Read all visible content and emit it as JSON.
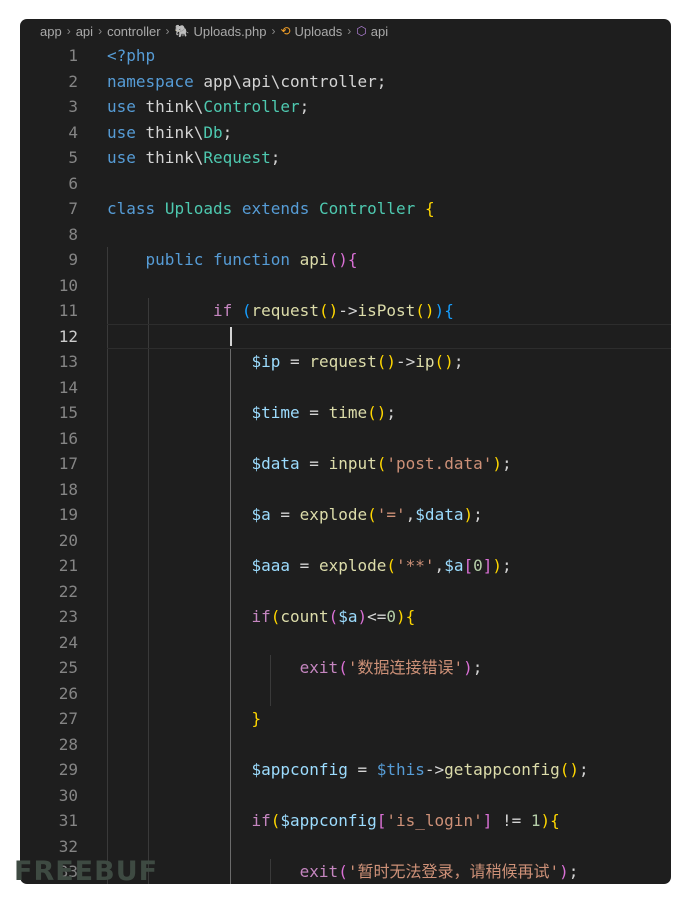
{
  "breadcrumb": [
    {
      "label": "app",
      "icon": null
    },
    {
      "label": "api",
      "icon": null
    },
    {
      "label": "controller",
      "icon": null
    },
    {
      "label": "Uploads.php",
      "icon": "php-file-icon"
    },
    {
      "label": "Uploads",
      "icon": "class-icon"
    },
    {
      "label": "api",
      "icon": "method-icon"
    }
  ],
  "editor": {
    "active_line": 12,
    "lines": [
      {
        "n": "1",
        "code": [
          [
            "<?php",
            "k"
          ]
        ]
      },
      {
        "n": "2",
        "code": [
          [
            "namespace",
            "k"
          ],
          [
            " app\\api\\controller;",
            "p"
          ]
        ]
      },
      {
        "n": "3",
        "code": [
          [
            "use",
            "k"
          ],
          [
            " think\\",
            "p"
          ],
          [
            "Controller",
            "t"
          ],
          [
            ";",
            "p"
          ]
        ]
      },
      {
        "n": "4",
        "code": [
          [
            "use",
            "k"
          ],
          [
            " think\\",
            "p"
          ],
          [
            "Db",
            "t"
          ],
          [
            ";",
            "p"
          ]
        ]
      },
      {
        "n": "5",
        "code": [
          [
            "use",
            "k"
          ],
          [
            " think\\",
            "p"
          ],
          [
            "Request",
            "t"
          ],
          [
            ";",
            "p"
          ]
        ]
      },
      {
        "n": "6",
        "code": []
      },
      {
        "n": "7",
        "code": [
          [
            "class",
            "k"
          ],
          [
            " ",
            "p"
          ],
          [
            "Uploads",
            "t"
          ],
          [
            " ",
            "p"
          ],
          [
            "extends",
            "k"
          ],
          [
            " ",
            "p"
          ],
          [
            "Controller",
            "t"
          ],
          [
            " ",
            "p"
          ],
          [
            "{",
            "b1"
          ]
        ]
      },
      {
        "n": "8",
        "code": []
      },
      {
        "n": "9",
        "code": [
          [
            "    ",
            "p"
          ],
          [
            "public",
            "k"
          ],
          [
            " ",
            "p"
          ],
          [
            "function",
            "k"
          ],
          [
            " ",
            "p"
          ],
          [
            "api",
            "f"
          ],
          [
            "()",
            "b2"
          ],
          [
            "{",
            "b2"
          ]
        ]
      },
      {
        "n": "10",
        "code": []
      },
      {
        "n": "11",
        "code": [
          [
            "           ",
            "p"
          ],
          [
            "if",
            "c"
          ],
          [
            " ",
            "p"
          ],
          [
            "(",
            "b3"
          ],
          [
            "request",
            "f"
          ],
          [
            "()",
            "b1"
          ],
          [
            "->",
            "p"
          ],
          [
            "isPost",
            "f"
          ],
          [
            "()",
            "b1"
          ],
          [
            ")",
            "b3"
          ],
          [
            "{",
            "b3"
          ]
        ]
      },
      {
        "n": "12",
        "code": []
      },
      {
        "n": "13",
        "code": [
          [
            "               ",
            "p"
          ],
          [
            "$ip",
            "v"
          ],
          [
            " = ",
            "p"
          ],
          [
            "request",
            "f"
          ],
          [
            "()",
            "b1"
          ],
          [
            "->",
            "p"
          ],
          [
            "ip",
            "f"
          ],
          [
            "()",
            "b1"
          ],
          [
            ";",
            "p"
          ]
        ]
      },
      {
        "n": "14",
        "code": []
      },
      {
        "n": "15",
        "code": [
          [
            "               ",
            "p"
          ],
          [
            "$time",
            "v"
          ],
          [
            " = ",
            "p"
          ],
          [
            "time",
            "f"
          ],
          [
            "()",
            "b1"
          ],
          [
            ";",
            "p"
          ]
        ]
      },
      {
        "n": "16",
        "code": []
      },
      {
        "n": "17",
        "code": [
          [
            "               ",
            "p"
          ],
          [
            "$data",
            "v"
          ],
          [
            " = ",
            "p"
          ],
          [
            "input",
            "f"
          ],
          [
            "(",
            "b1"
          ],
          [
            "'post.data'",
            "s"
          ],
          [
            ")",
            "b1"
          ],
          [
            ";",
            "p"
          ]
        ]
      },
      {
        "n": "18",
        "code": []
      },
      {
        "n": "19",
        "code": [
          [
            "               ",
            "p"
          ],
          [
            "$a",
            "v"
          ],
          [
            " = ",
            "p"
          ],
          [
            "explode",
            "f"
          ],
          [
            "(",
            "b1"
          ],
          [
            "'='",
            "s"
          ],
          [
            ",",
            "p"
          ],
          [
            "$data",
            "v"
          ],
          [
            ")",
            "b1"
          ],
          [
            ";",
            "p"
          ]
        ]
      },
      {
        "n": "20",
        "code": []
      },
      {
        "n": "21",
        "code": [
          [
            "               ",
            "p"
          ],
          [
            "$aaa",
            "v"
          ],
          [
            " = ",
            "p"
          ],
          [
            "explode",
            "f"
          ],
          [
            "(",
            "b1"
          ],
          [
            "'**'",
            "s"
          ],
          [
            ",",
            "p"
          ],
          [
            "$a",
            "v"
          ],
          [
            "[",
            "b2"
          ],
          [
            "0",
            "n"
          ],
          [
            "]",
            "b2"
          ],
          [
            ")",
            "b1"
          ],
          [
            ";",
            "p"
          ]
        ]
      },
      {
        "n": "22",
        "code": []
      },
      {
        "n": "23",
        "code": [
          [
            "               ",
            "p"
          ],
          [
            "if",
            "c"
          ],
          [
            "(",
            "b1"
          ],
          [
            "count",
            "f"
          ],
          [
            "(",
            "b2"
          ],
          [
            "$a",
            "v"
          ],
          [
            ")",
            "b2"
          ],
          [
            "<=",
            "p"
          ],
          [
            "0",
            "n"
          ],
          [
            ")",
            "b1"
          ],
          [
            "{",
            "b1"
          ]
        ]
      },
      {
        "n": "24",
        "code": []
      },
      {
        "n": "25",
        "code": [
          [
            "                    ",
            "p"
          ],
          [
            "exit",
            "c"
          ],
          [
            "(",
            "b2"
          ],
          [
            "'数据连接错误'",
            "s"
          ],
          [
            ")",
            "b2"
          ],
          [
            ";",
            "p"
          ]
        ]
      },
      {
        "n": "26",
        "code": []
      },
      {
        "n": "27",
        "code": [
          [
            "               ",
            "p"
          ],
          [
            "}",
            "b1"
          ]
        ]
      },
      {
        "n": "28",
        "code": []
      },
      {
        "n": "29",
        "code": [
          [
            "               ",
            "p"
          ],
          [
            "$appconfig",
            "v"
          ],
          [
            " = ",
            "p"
          ],
          [
            "$this",
            "k"
          ],
          [
            "->",
            "p"
          ],
          [
            "getappconfig",
            "f"
          ],
          [
            "()",
            "b1"
          ],
          [
            ";",
            "p"
          ]
        ]
      },
      {
        "n": "30",
        "code": []
      },
      {
        "n": "31",
        "code": [
          [
            "               ",
            "p"
          ],
          [
            "if",
            "c"
          ],
          [
            "(",
            "b1"
          ],
          [
            "$appconfig",
            "v"
          ],
          [
            "[",
            "b2"
          ],
          [
            "'is_login'",
            "s"
          ],
          [
            "]",
            "b2"
          ],
          [
            " != ",
            "p"
          ],
          [
            "1",
            "n"
          ],
          [
            ")",
            "b1"
          ],
          [
            "{",
            "b1"
          ]
        ]
      },
      {
        "n": "32",
        "code": []
      },
      {
        "n": "33",
        "code": [
          [
            "                    ",
            "p"
          ],
          [
            "exit",
            "c"
          ],
          [
            "(",
            "b2"
          ],
          [
            "'暂时无法登录，请稍候再试'",
            "s"
          ],
          [
            ")",
            "b2"
          ],
          [
            ";",
            "p"
          ]
        ]
      }
    ]
  },
  "watermark": "FREEBUF"
}
